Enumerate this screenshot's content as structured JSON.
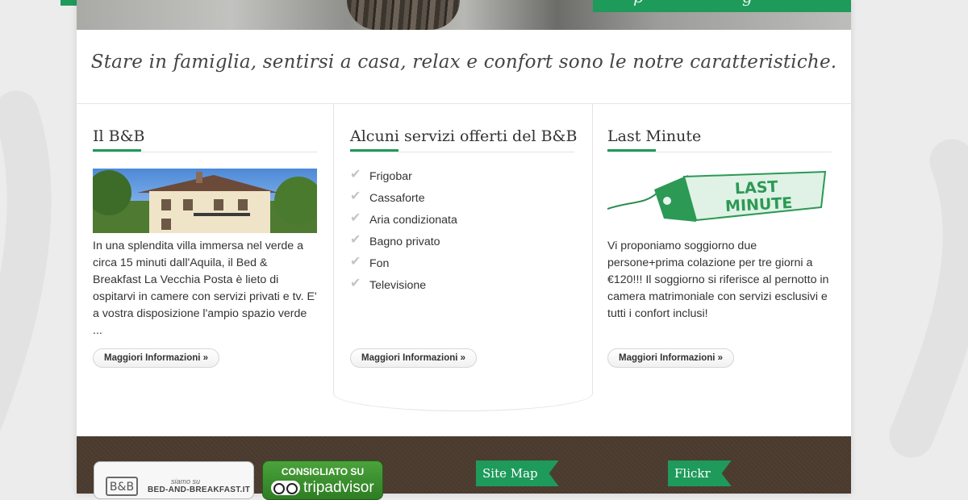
{
  "hero": {
    "right_tab_glyphs": [
      "p",
      "g"
    ]
  },
  "tagline": "Stare in famiglia, sentirsi a casa, relax e confort sono le notre caratteristiche.",
  "columns": {
    "bb": {
      "title": "Il B&B",
      "text": "In una splendita villa immersa nel verde a circa 15 minuti dall'Aquila, il Bed & Breakfast La Vecchia Posta è lieto di ospitarvi in camere con servizi privati e tv. E' a vostra disposizione l'ampio spazio verde ...",
      "button": "Maggiori Informazioni »"
    },
    "services": {
      "title": "Alcuni servizi offerti del B&B",
      "items": [
        "Frigobar",
        "Cassaforte",
        "Aria condizionata",
        "Bagno privato",
        "Fon",
        "Televisione"
      ],
      "button": "Maggiori Informazioni »"
    },
    "last_minute": {
      "title": "Last Minute",
      "banner_line1": "LAST",
      "banner_line2": "MINUTE",
      "text": "Vi proponiamo soggiorno due persone+prima colazione per tre giorni a €120!!! Il soggiorno si riferisce al pernotto in camera matrimoniale con servizi esclusivi e tutti i confort inclusi!",
      "button": "Maggiori Informazioni »"
    }
  },
  "footer": {
    "badge_bb": {
      "tagline": "siamo su",
      "site": "BED-AND-BREAKFAST.IT",
      "logo": "B&B"
    },
    "badge_ta": {
      "title": "CONSIGLIATO SU",
      "brand": "tripadvisor"
    },
    "sitemap": "Site Map",
    "flickr": "Flickr"
  },
  "colors": {
    "accent": "#1e9a5b",
    "footer_bg": "#4a3a2e",
    "text": "#333333"
  }
}
